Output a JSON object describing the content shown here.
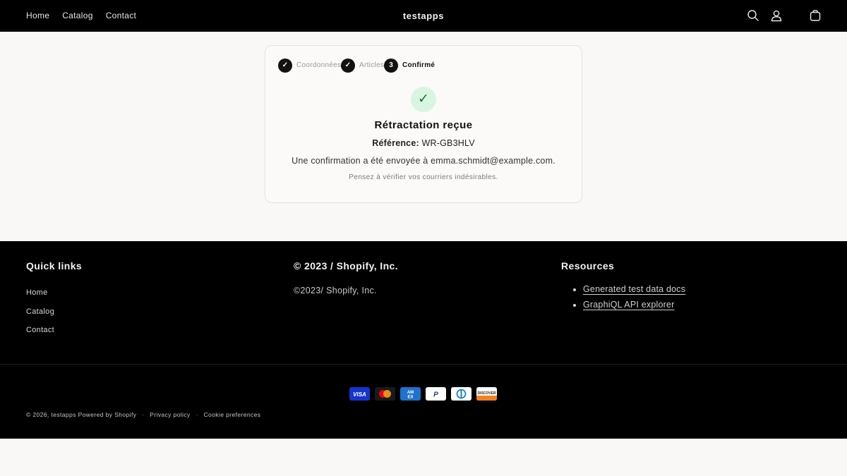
{
  "header": {
    "nav": [
      "Home",
      "Catalog",
      "Contact"
    ],
    "brand": "testapps",
    "icons": [
      "search-icon",
      "account-icon",
      "cart-icon"
    ]
  },
  "steps": [
    {
      "badge": "✓",
      "label": "Coordonnées",
      "state": "done"
    },
    {
      "badge": "✓",
      "label": "Articles",
      "state": "done"
    },
    {
      "badge": "3",
      "label": "Confirmé",
      "state": "active"
    }
  ],
  "confirmation": {
    "icon": "✓",
    "title": "Rétractation reçue",
    "reference_label": "Référence:",
    "reference_value": "WR-GB3HLV",
    "message": "Une confirmation a été envoyée à emma.schmidt@example.com.",
    "note": "Pensez à vérifier vos courriers indésirables."
  },
  "footer": {
    "quick_links_title": "Quick links",
    "quick_links": [
      "Home",
      "Catalog",
      "Contact"
    ],
    "company_title": "© 2023 / Shopify, Inc.",
    "company_text": "©2023/ Shopify, Inc.",
    "resources_title": "Resources",
    "resources": [
      "Generated test data docs",
      "GraphiQL API explorer"
    ],
    "payment_icons": [
      "visa-icon",
      "mastercard-icon",
      "amex-icon",
      "paypal-icon",
      "diners-club-icon",
      "discover-icon"
    ],
    "copyright": "© 2026, testapps",
    "powered_by": "Powered by Shopify",
    "bottom_separator": "·",
    "privacy": "Privacy policy",
    "cookies": "Cookie preferences"
  },
  "colors": {
    "header_bg": "#000000",
    "page_bg": "#f9f8f6",
    "success_bg": "#d8f5e2",
    "step_badge": "#121212"
  }
}
